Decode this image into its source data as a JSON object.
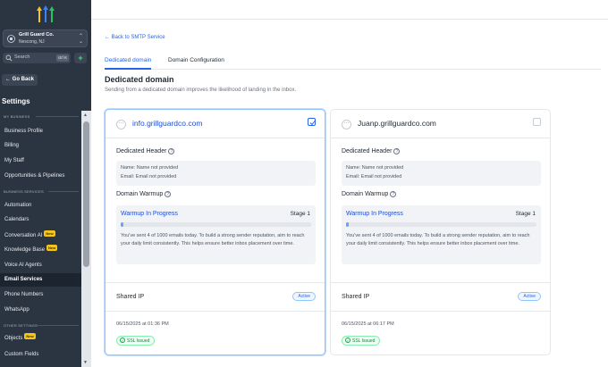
{
  "account": {
    "name": "Grill Guard Co.",
    "location": "Nescong, NJ"
  },
  "search": {
    "placeholder": "Search",
    "shortcut": "ctrl K"
  },
  "sidebar": {
    "go_back": "← Go Back",
    "title": "Settings",
    "sections": {
      "my_business": "MY BUSINESS",
      "business_services": "BUSINESS SERVICES",
      "other_settings": "OTHER SETTINGS"
    },
    "items": [
      {
        "label": "Business Profile"
      },
      {
        "label": "Billing"
      },
      {
        "label": "My Staff"
      },
      {
        "label": "Opportunities & Pipelines"
      },
      {
        "label": "Automation"
      },
      {
        "label": "Calendars"
      },
      {
        "label": "Conversation AI",
        "badge": "New"
      },
      {
        "label": "Knowledge Base",
        "badge": "New"
      },
      {
        "label": "Voice AI Agents"
      },
      {
        "label": "Email Services",
        "active": true
      },
      {
        "label": "Phone Numbers"
      },
      {
        "label": "WhatsApp"
      },
      {
        "label": "Objects",
        "badge": "New"
      },
      {
        "label": "Custom Fields"
      }
    ]
  },
  "main": {
    "back_link": "← Back to SMTP Service",
    "tabs": [
      {
        "label": "Dedicated domain",
        "active": true
      },
      {
        "label": "Domain Configuration",
        "active": false
      }
    ],
    "heading": "Dedicated domain",
    "subheading": "Sending from a dedicated domain improves the likelihood of landing in the inbox."
  },
  "cards": [
    {
      "domain": "info.grillguardco.com",
      "selected": true,
      "dedicated_header_label": "Dedicated Header",
      "name_line": "Name: Name not provided",
      "email_line": "Email: Email not provided",
      "warmup_label": "Domain Warmup",
      "warmup_status": "Warmup In Progress",
      "warmup_stage": "Stage 1",
      "warmup_progress": 0.004,
      "warmup_desc": "You've sent 4 of 1000 emails today. To build a strong sender reputation, aim to reach your daily limit consistently. This helps ensure better inbox placement over time.",
      "shared_ip_label": "Shared IP",
      "ip_status": "Active",
      "date": "06/15/2025 at 01:36 PM",
      "ssl": "SSL Issued"
    },
    {
      "domain": "Juanp.grillguardco.com",
      "selected": false,
      "dedicated_header_label": "Dedicated Header",
      "name_line": "Name: Name not provided",
      "email_line": "Email: Email not provided",
      "warmup_label": "Domain Warmup",
      "warmup_status": "Warmup In Progress",
      "warmup_stage": "Stage 1",
      "warmup_progress": 0.004,
      "warmup_desc": "You've sent 4 of 1000 emails today. To build a strong sender reputation, aim to reach your daily limit consistently. This helps ensure better inbox placement over time.",
      "shared_ip_label": "Shared IP",
      "ip_status": "Active",
      "date": "06/15/2025 at 06:17 PM",
      "ssl": "SSL Issued"
    }
  ],
  "colors": {
    "accent": "#2563eb",
    "sidebar_bg": "#2b3441",
    "success": "#16a34a"
  }
}
